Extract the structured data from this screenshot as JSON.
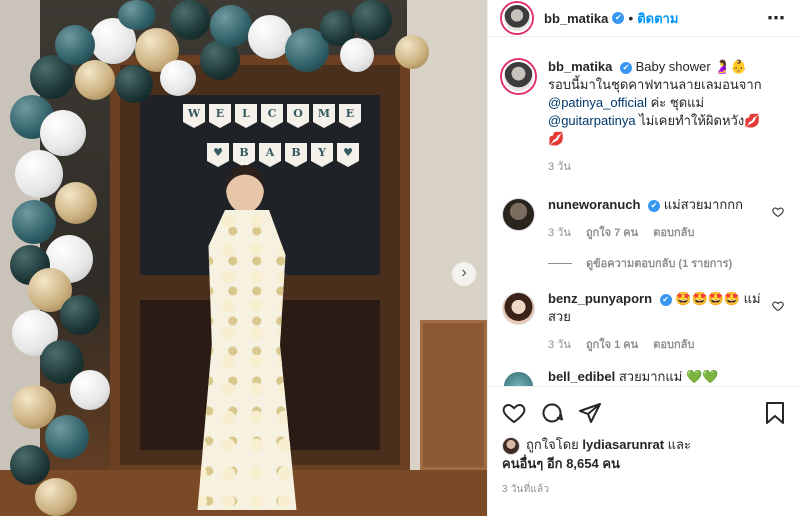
{
  "header": {
    "username": "bb_matika",
    "verified_badge": "✔",
    "separator": "•",
    "follow_label": "ติดตาม",
    "more_label": "⋯"
  },
  "caption": {
    "username": "bb_matika",
    "text_line1": "Baby shower 🤰👶",
    "text_line2": "รอบนี้มาในชุดคาฟทานลายเลมอนจาก",
    "mention1": "@patinya_official",
    "text_line3": " ค่ะ ชุดแม่",
    "mention2": "@guitarpatinya",
    "text_line4": " ไม่เคยทำให้ผิดหวัง💋💋",
    "time": "3 วัน"
  },
  "comments": [
    {
      "username": "nuneworanuch",
      "text": "แม่สวยมากกก",
      "time": "3 วัน",
      "likes": "ถูกใจ 7 คน",
      "reply": "ตอบกลับ"
    },
    {
      "username": "benz_punyaporn",
      "text": "🤩🤩🤩🤩 แม่สวย",
      "time": "3 วัน",
      "likes": "ถูกใจ 1 คน",
      "reply": "ตอบกลับ"
    },
    {
      "username": "bell_edibel",
      "text": "สวยมากแม่ 💚💚"
    }
  ],
  "view_replies": "ดูข้อความตอบกลับ (1 รายการ)",
  "likes_section": {
    "liked_by_prefix": "ถูกใจโดย",
    "liked_by_user": "lydiasarunrat",
    "liked_by_and": "และ",
    "others_prefix": "คนอื่นๆ อีก",
    "others_count": "8,654",
    "others_suffix": "คน"
  },
  "timestamp": "3 วันที่แล้ว",
  "banner": {
    "top": [
      "W",
      "E",
      "L",
      "C",
      "O",
      "M",
      "E"
    ],
    "bottom": [
      "♥",
      "B",
      "A",
      "B",
      "Y",
      "♥"
    ]
  },
  "colors": {
    "follow_blue": "#0095f6",
    "verified_blue": "#3897f0",
    "meta_gray": "#8e8e8e"
  },
  "icons": {
    "like": "heart-outline",
    "comment": "comment-bubble",
    "share": "paper-plane",
    "save": "bookmark-outline",
    "photo_next": "chevron-right"
  }
}
